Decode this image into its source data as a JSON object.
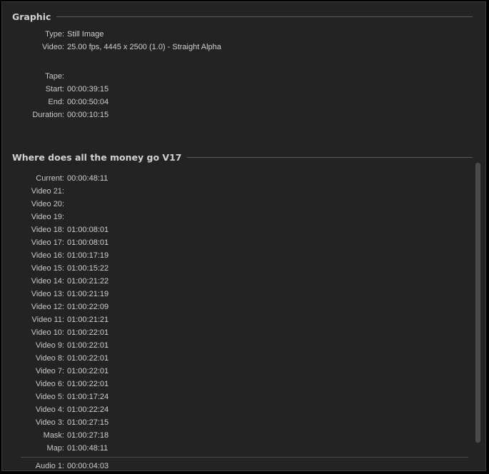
{
  "graphic": {
    "title": "Graphic",
    "rows": [
      {
        "label": "Type:",
        "value": "Still Image"
      },
      {
        "label": "Video:",
        "value": "25.00 fps, 4445 x 2500 (1.0) - Straight Alpha"
      },
      {
        "label": "Tape:",
        "value": ""
      },
      {
        "label": "Start:",
        "value": "00:00:39:15"
      },
      {
        "label": "End:",
        "value": "00:00:50:04"
      },
      {
        "label": "Duration:",
        "value": "00:00:10:15"
      }
    ]
  },
  "sequence": {
    "title": "Where does all the money go V17",
    "rows": [
      {
        "label": "Current:",
        "value": "00:00:48:11"
      },
      {
        "label": "Video 21:",
        "value": ""
      },
      {
        "label": "Video 20:",
        "value": ""
      },
      {
        "label": "Video 19:",
        "value": ""
      },
      {
        "label": "Video 18:",
        "value": "01:00:08:01"
      },
      {
        "label": "Video 17:",
        "value": "01:00:08:01"
      },
      {
        "label": "Video 16:",
        "value": "01:00:17:19"
      },
      {
        "label": "Video 15:",
        "value": "01:00:15:22"
      },
      {
        "label": "Video 14:",
        "value": "01:00:21:22"
      },
      {
        "label": "Video 13:",
        "value": "01:00:21:19"
      },
      {
        "label": "Video 12:",
        "value": "01:00:22:09"
      },
      {
        "label": "Video 11:",
        "value": "01:00:21:21"
      },
      {
        "label": "Video 10:",
        "value": "01:00:22:01"
      },
      {
        "label": "Video 9:",
        "value": "01:00:22:01"
      },
      {
        "label": "Video 8:",
        "value": "01:00:22:01"
      },
      {
        "label": "Video 7:",
        "value": "01:00:22:01"
      },
      {
        "label": "Video 6:",
        "value": "01:00:22:01"
      },
      {
        "label": "Video 5:",
        "value": "01:00:17:24"
      },
      {
        "label": "Video 4:",
        "value": "01:00:22:24"
      },
      {
        "label": "Video 3:",
        "value": "01:00:27:15"
      },
      {
        "label": "Mask:",
        "value": "01:00:27:18"
      },
      {
        "label": "Map:",
        "value": "01:00:48:11"
      }
    ],
    "cut_row": {
      "label": "Audio 1:",
      "value": "00:00:04:03"
    }
  }
}
